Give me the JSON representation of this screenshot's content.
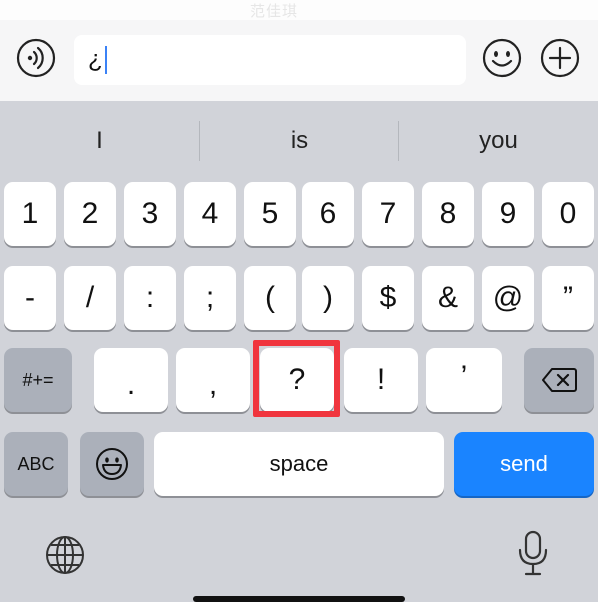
{
  "watermark": "范佳琪",
  "input": {
    "value": "¿"
  },
  "suggestions": [
    "I",
    "is",
    "you"
  ],
  "row1": [
    "1",
    "2",
    "3",
    "4",
    "5",
    "6",
    "7",
    "8",
    "9",
    "0"
  ],
  "row2": [
    "-",
    "/",
    ":",
    ";",
    "(",
    ")",
    "$",
    "&",
    "@",
    "”"
  ],
  "row3": {
    "switch_label": "#+=",
    "keys": [
      ".",
      ",",
      "?",
      "!",
      "’"
    ]
  },
  "row4": {
    "abc_label": "ABC",
    "space_label": "space",
    "send_label": "send"
  },
  "colors": {
    "send": "#1a84ff",
    "highlight": "#f0353e",
    "caret": "#3b82f6"
  }
}
